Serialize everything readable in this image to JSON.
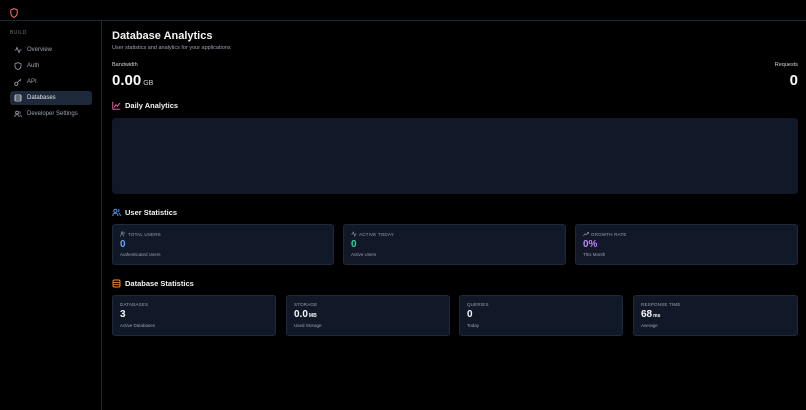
{
  "sidebar": {
    "section": "BUILD",
    "items": [
      {
        "label": "Overview",
        "icon": "activity-icon"
      },
      {
        "label": "Auth",
        "icon": "shield-icon"
      },
      {
        "label": "API",
        "icon": "key-icon"
      },
      {
        "label": "Databases",
        "icon": "database-icon",
        "active": true
      },
      {
        "label": "Developer Settings",
        "icon": "users-icon"
      }
    ]
  },
  "header": {
    "title": "Database Analytics",
    "subtitle": "User statistics and analytics for your applications"
  },
  "metrics": {
    "bandwidth": {
      "label": "Bandwidth",
      "value": "0.00",
      "unit": "GB"
    },
    "requests": {
      "label": "Requests",
      "value": "0"
    }
  },
  "daily": {
    "title": "Daily Analytics"
  },
  "user_stats": {
    "title": "User Statistics",
    "cards": [
      {
        "label": "TOTAL USERS",
        "value": "0",
        "sub": "Authenticated Users",
        "color": "#60a5fa"
      },
      {
        "label": "ACTIVE TODAY",
        "value": "0",
        "sub": "Active Users",
        "color": "#34d399"
      },
      {
        "label": "GROWTH RATE",
        "value": "0%",
        "sub": "This Month",
        "color": "#c084fc"
      }
    ]
  },
  "db_stats": {
    "title": "Database Statistics",
    "cards": [
      {
        "label": "DATABASES",
        "value": "3",
        "unit": "",
        "sub": "Active Databases"
      },
      {
        "label": "STORAGE",
        "value": "0.0",
        "unit": "MB",
        "sub": "Used Storage"
      },
      {
        "label": "QUERIES",
        "value": "0",
        "unit": "",
        "sub": "Today"
      },
      {
        "label": "RESPONSE TIME",
        "value": "68",
        "unit": "ms",
        "sub": "Average"
      }
    ]
  },
  "colors": {
    "accent_red": "#f87171",
    "chart_icon": "#f472b6",
    "user_icon": "#60a5fa",
    "db_icon": "#fb923c"
  }
}
